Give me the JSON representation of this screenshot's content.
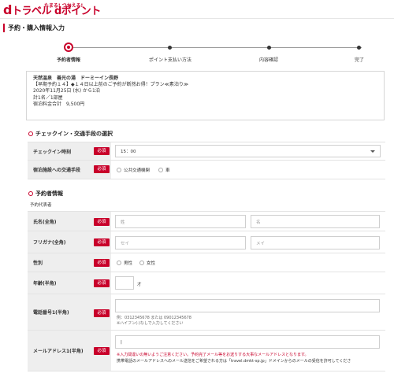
{
  "header": {
    "logo_d": "d",
    "logo_text": "トラベル",
    "logo_point": "dポイント",
    "tagline": "たまる! つかえる!"
  },
  "page_title": "予約・購入情報入力",
  "steps": [
    {
      "label": "予約者情報",
      "active": true
    },
    {
      "label": "ポイント支払い方法",
      "active": false
    },
    {
      "label": "内容確認",
      "active": false
    },
    {
      "label": "完了",
      "active": false
    }
  ],
  "plan": {
    "hotel": "天然温泉　善光の湯　ドーミーイン長野",
    "plan_name": "【早期予約１４】◆１４日以上前のご予約が断然お得！プラン≪素泊り≫",
    "date": "2020年11月25日 (水) から1泊",
    "guests": "計1名／1部屋",
    "total": "宿泊料金合計　9,500円"
  },
  "checkin_section": {
    "title": "チェックイン・交通手段の選択",
    "time_label": "チェックイン時刻",
    "time_required": "必須",
    "time_value": "15：00",
    "transport_label": "宿泊施設への交通手段",
    "transport_options": [
      "公共交通機関",
      "車"
    ]
  },
  "reserver_section": {
    "title": "予約者情報",
    "subtitle": "予約代表者",
    "name_label": "氏名(全角)",
    "name_required": "必須",
    "last_placeholder": "姓",
    "first_placeholder": "名",
    "kana_label": "フリガナ(全角)",
    "kana_required": "必須",
    "kana_last_placeholder": "セイ",
    "kana_first_placeholder": "メイ",
    "gender_label": "性別",
    "gender_required": "必須",
    "gender_options": [
      "男性",
      "女性"
    ],
    "age_label": "年齢(半角)",
    "age_required": "必須",
    "age_unit": "才",
    "phone_label": "電話番号1(半角)",
    "phone_required": "必須",
    "phone_example": "例：0312345678 または 09012345678",
    "phone_note": "※ハイフン(-)なしで入力してください",
    "email_label": "メールアドレス1(半角)",
    "email_required": "必須",
    "email_value": "|",
    "email_warn": "※入力間違いの無いようご注意ください。予約完了メール等をお送りする大事なメールアドレスとなります。",
    "email_note": "携帯電話のメールアドレスへのメール送信をご希望される方は「travel.dmkt-sp.jp」ドメインからのメールの受信を許可してくださ"
  }
}
